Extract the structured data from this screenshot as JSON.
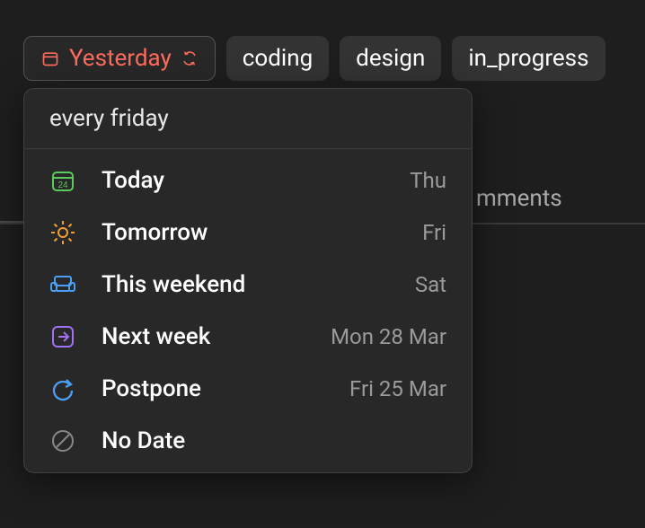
{
  "pills": {
    "date": {
      "label": "Yesterday",
      "color": "#ff6b5d"
    },
    "tags": [
      "coding",
      "design",
      "in_progress"
    ]
  },
  "popover": {
    "search_value": "every friday",
    "options": [
      {
        "key": "today",
        "label": "Today",
        "meta": "Thu",
        "icon": "calendar-today",
        "color": "#5cc95c"
      },
      {
        "key": "tomorrow",
        "label": "Tomorrow",
        "meta": "Fri",
        "icon": "sun",
        "color": "#f0a030"
      },
      {
        "key": "this-weekend",
        "label": "This weekend",
        "meta": "Sat",
        "icon": "couch",
        "color": "#4a9ff5"
      },
      {
        "key": "next-week",
        "label": "Next week",
        "meta": "Mon 28 Mar",
        "icon": "arrow-next",
        "color": "#a070f5"
      },
      {
        "key": "postpone",
        "label": "Postpone",
        "meta": "Fri 25 Mar",
        "icon": "redo",
        "color": "#4a9ff5"
      },
      {
        "key": "no-date",
        "label": "No Date",
        "meta": "",
        "icon": "no-date",
        "color": "#888888"
      }
    ]
  },
  "behind": {
    "comments_fragment": "mments"
  }
}
